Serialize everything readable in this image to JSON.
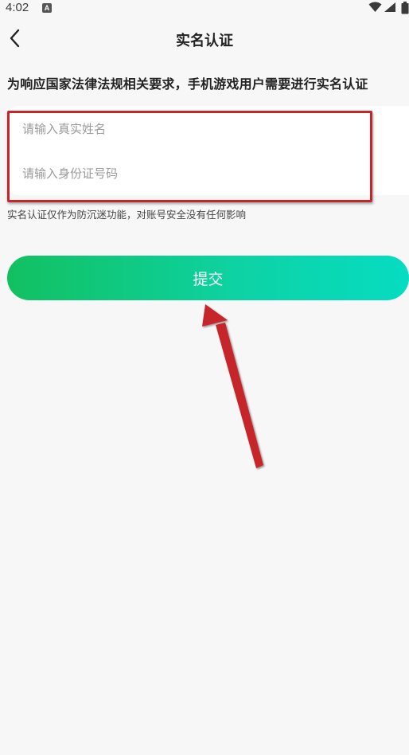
{
  "status_bar": {
    "time": "4:02",
    "app_icon": "A"
  },
  "nav": {
    "title": "实名认证"
  },
  "notice": "为响应国家法律法规相关要求，手机游戏用户需要进行实名认证",
  "form": {
    "name_placeholder": "请输入真实姓名",
    "name_value": "",
    "id_placeholder": "请输入身份证号码",
    "id_value": ""
  },
  "hint": "实名认证仅作为防沉迷功能，对账号安全没有任何影响",
  "submit_label": "提交",
  "colors": {
    "background": "#f7f7f7",
    "button_gradient_start": "#12c060",
    "button_gradient_end": "#06dcc2",
    "annotation_red": "#c6262a"
  },
  "icons": {
    "back": "chevron-left-icon",
    "wifi": "wifi-icon",
    "signal": "cell-signal-icon",
    "battery": "battery-icon"
  }
}
